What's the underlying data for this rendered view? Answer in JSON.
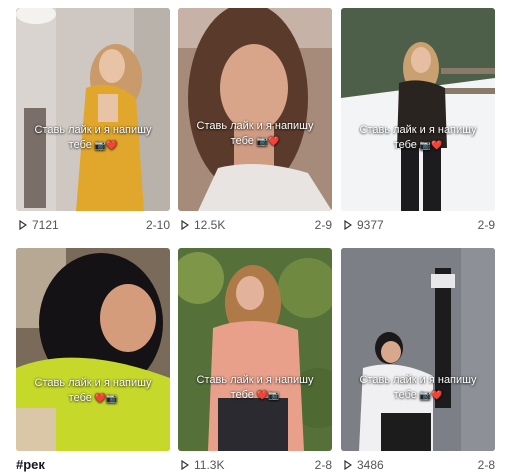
{
  "videos": [
    {
      "views": "7121",
      "date": "2-10",
      "caption_line1": "Ставь лайк и я напишу",
      "caption_line2": "тебе",
      "emoji": "📷❤️",
      "tag": ""
    },
    {
      "views": "12.5K",
      "date": "2-9",
      "caption_line1": "Ставь лайк и я напишу",
      "caption_line2": "тебе",
      "emoji": "📷❤️",
      "tag": ""
    },
    {
      "views": "9377",
      "date": "2-9",
      "caption_line1": "Ставь лайк и я напишу",
      "caption_line2": "тебе",
      "emoji": "📷❤️",
      "tag": ""
    },
    {
      "views": "",
      "date": "",
      "caption_line1": "Ставь лайк и я напишу",
      "caption_line2": "тебе",
      "emoji": "❤️📷",
      "tag": "#рек"
    },
    {
      "views": "11.3K",
      "date": "2-8",
      "caption_line1": "Ставь лайк и я напишу",
      "caption_line2": "тебе",
      "emoji": "❤️📷",
      "tag": ""
    },
    {
      "views": "3486",
      "date": "2-8",
      "caption_line1": "Ставь лайк и я напишу",
      "caption_line2": "тебе",
      "emoji": "📷❤️",
      "tag": ""
    }
  ],
  "icons": {
    "views": "play-outline-icon"
  }
}
